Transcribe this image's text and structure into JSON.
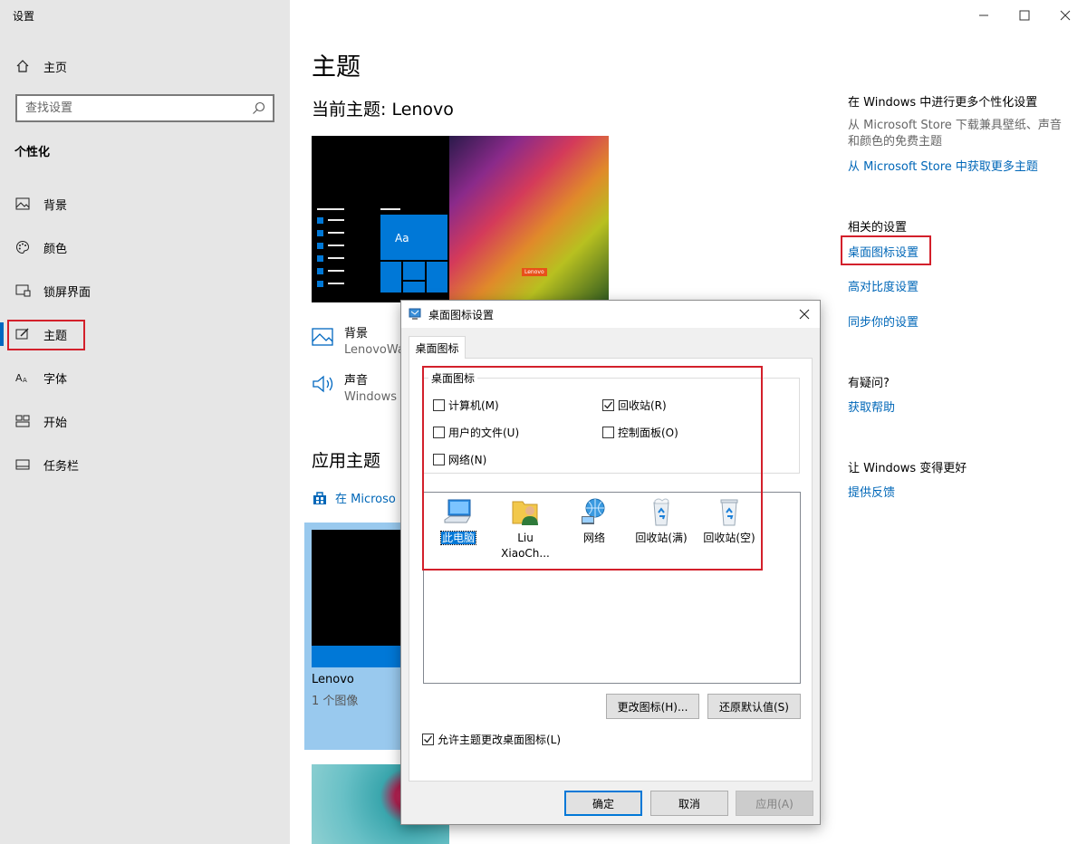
{
  "app": {
    "title": "设置"
  },
  "sidebar": {
    "home": "主页",
    "search_placeholder": "查找设置",
    "section": "个性化",
    "items": [
      {
        "label": "背景"
      },
      {
        "label": "颜色"
      },
      {
        "label": "锁屏界面"
      },
      {
        "label": "主题"
      },
      {
        "label": "字体"
      },
      {
        "label": "开始"
      },
      {
        "label": "任务栏"
      }
    ]
  },
  "main": {
    "title": "主题",
    "current_theme": "当前主题: Lenovo",
    "preview_brand": "Lenovo",
    "preview_tile_text": "Aa",
    "rows": [
      {
        "title": "背景",
        "value": "LenovoWa"
      },
      {
        "title": "声音",
        "value": "Windows"
      }
    ],
    "app_theme_title": "应用主题",
    "store_link": "在 Microso",
    "theme_card": {
      "name": "Lenovo",
      "count": "1 个图像"
    }
  },
  "right": {
    "more_title": "在 Windows 中进行更多个性化设置",
    "more_desc": "从 Microsoft Store 下载兼具壁纸、声音和颜色的免费主题",
    "more_link": "从 Microsoft Store 中获取更多主题",
    "related_title": "相关的设置",
    "related_links": [
      "桌面图标设置",
      "高对比度设置",
      "同步你的设置"
    ],
    "question_title": "有疑问?",
    "help_link": "获取帮助",
    "better_title": "让 Windows 变得更好",
    "feedback_link": "提供反馈"
  },
  "dialog": {
    "title": "桌面图标设置",
    "tab": "桌面图标",
    "group_label": "桌面图标",
    "checkboxes": [
      {
        "label": "计算机(M)",
        "checked": false
      },
      {
        "label": "回收站(R)",
        "checked": true
      },
      {
        "label": "用户的文件(U)",
        "checked": false
      },
      {
        "label": "控制面板(O)",
        "checked": false
      },
      {
        "label": "网络(N)",
        "checked": false
      }
    ],
    "icons": [
      {
        "label": "此电脑",
        "icon": "computer-icon",
        "selected": true
      },
      {
        "label": "Liu XiaoCh...",
        "icon": "user-folder-icon",
        "selected": false
      },
      {
        "label": "网络",
        "icon": "network-icon",
        "selected": false
      },
      {
        "label": "回收站(满)",
        "icon": "recycle-bin-full-icon",
        "selected": false
      },
      {
        "label": "回收站(空)",
        "icon": "recycle-bin-empty-icon",
        "selected": false
      }
    ],
    "change_icon": "更改图标(H)...",
    "restore_default": "还原默认值(S)",
    "allow_themes": "允许主题更改桌面图标(L)",
    "allow_themes_checked": true,
    "ok": "确定",
    "cancel": "取消",
    "apply": "应用(A)"
  },
  "colors": {
    "accent": "#0078d7",
    "link": "#0067b8",
    "highlight_box": "#d3202b"
  }
}
